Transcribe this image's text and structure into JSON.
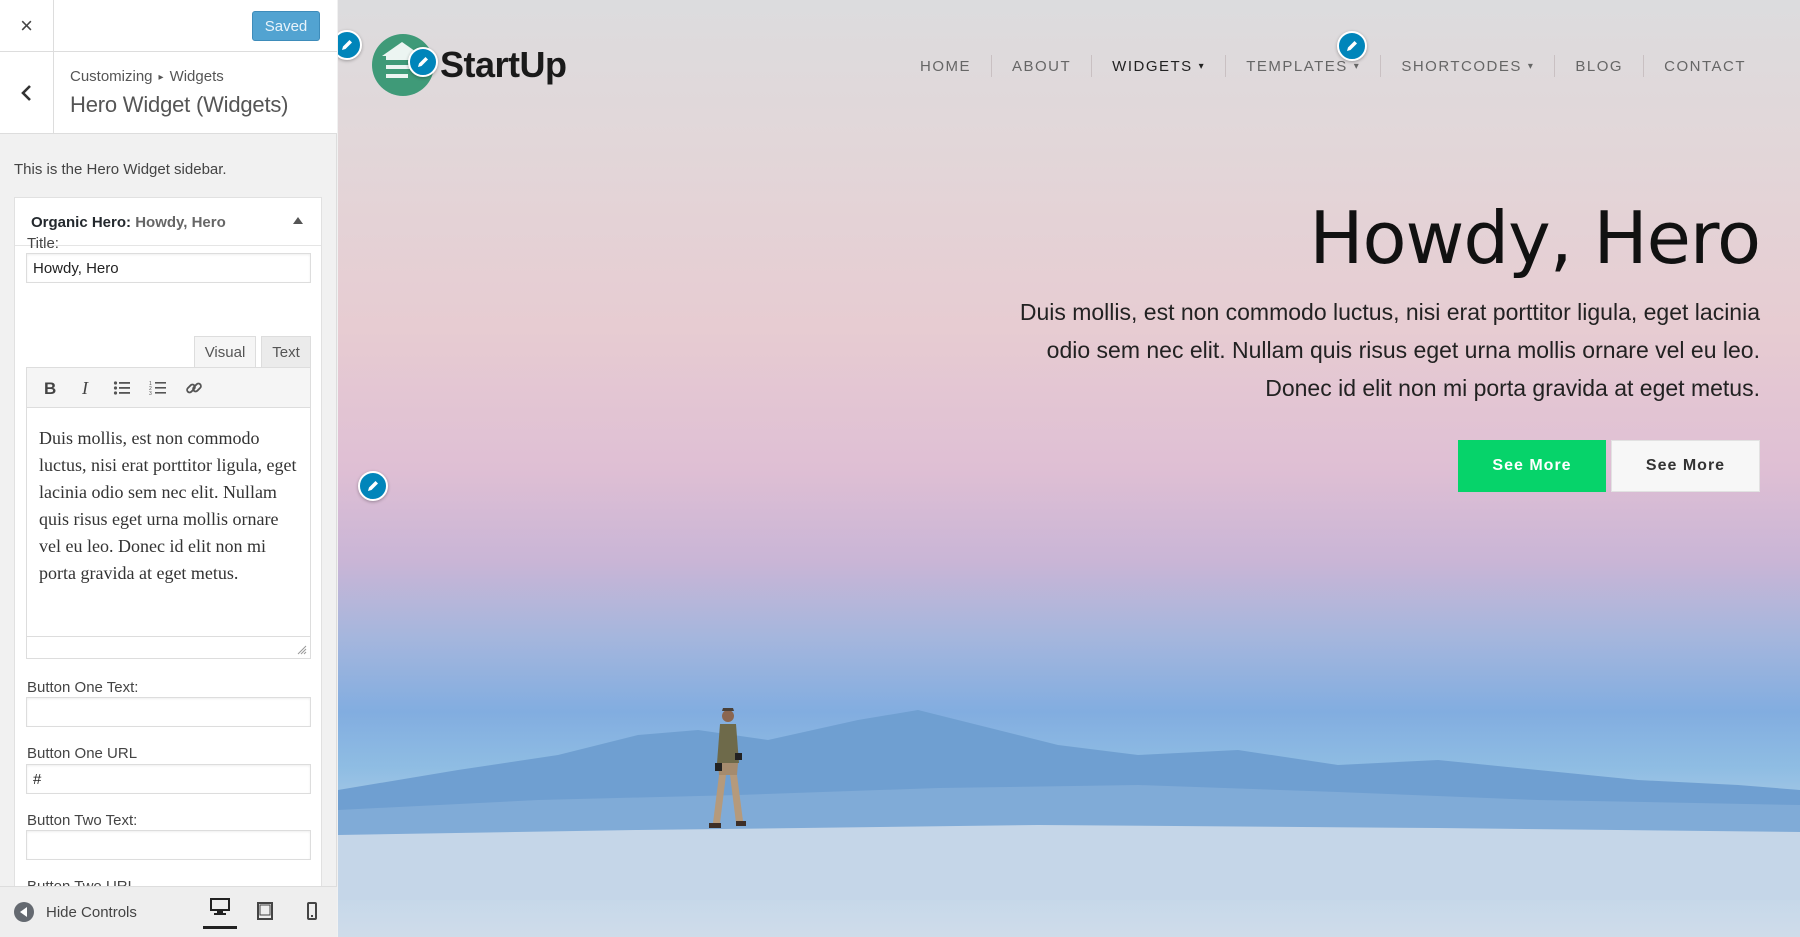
{
  "panel": {
    "close_icon": "×",
    "saved_label": "Saved",
    "breadcrumb_parent": "Customizing",
    "breadcrumb_section": "Widgets",
    "section_title": "Hero Widget (Widgets)",
    "sidebar_description": "This is the Hero Widget sidebar.",
    "widget": {
      "name": "Organic Hero",
      "separator": ":",
      "instance_title": "Howdy, Hero",
      "title_label": "Title:",
      "title_value": "Howdy, Hero",
      "editor_tabs": [
        "Visual",
        "Text"
      ],
      "toolbar": [
        "bold-icon",
        "italic-icon",
        "bulleted-list-icon",
        "numbered-list-icon",
        "link-icon"
      ],
      "body_text": "Duis mollis, est non commodo luctus, nisi erat porttitor ligula, eget lacinia odio sem nec elit. Nullam quis risus eget urna mollis ornare vel eu leo. Donec id elit non mi porta gravida at eget metus.",
      "button_one_text_label": "Button One Text:",
      "button_one_text_value": "",
      "button_one_url_label": "Button One URL",
      "button_one_url_value": "#",
      "button_two_text_label": "Button Two Text:",
      "button_two_text_value": "",
      "button_two_url_label": "Button Two URL"
    },
    "footer": {
      "hide_controls_label": "Hide Controls",
      "devices": [
        "desktop-icon",
        "tablet-icon",
        "mobile-icon"
      ]
    }
  },
  "preview": {
    "logo_text": "StartUp",
    "nav": [
      {
        "label": "HOME",
        "dropdown": false
      },
      {
        "label": "ABOUT",
        "dropdown": false
      },
      {
        "label": "WIDGETS",
        "dropdown": true,
        "active": true
      },
      {
        "label": "TEMPLATES",
        "dropdown": true
      },
      {
        "label": "SHORTCODES",
        "dropdown": true
      },
      {
        "label": "BLOG",
        "dropdown": false
      },
      {
        "label": "CONTACT",
        "dropdown": false
      }
    ],
    "chevron": "⌄",
    "hero_title": "Howdy, Hero",
    "hero_text": "Duis mollis, est non commodo luctus, nisi erat porttitor ligula, eget lacinia odio sem nec elit. Nullam quis risus eget urna mollis ornare vel eu leo. Donec id elit non mi porta gravida at eget metus.",
    "button_one": "See More",
    "button_two": "See More"
  },
  "colors": {
    "accent_blue": "#0085ba",
    "saved_button": "#52a3d1",
    "primary_button": "#06d36a",
    "logo_green": "#3f9a78"
  }
}
